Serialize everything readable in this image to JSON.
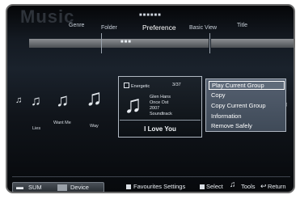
{
  "watermark": "Music",
  "nav_dots": "■■■■■■",
  "tabs": [
    "Genre",
    "Folder",
    "Preference",
    "Basic View",
    "Title"
  ],
  "bar_dots": "■■■",
  "songs": [
    "Lies",
    "Want Me",
    "Way"
  ],
  "selected_song": {
    "checkbox_label": "Energetic",
    "count": "3/37",
    "artist": "Glen Hans",
    "album": "Once Ost",
    "year": "2007",
    "genre": "Soundtrack",
    "title": "I Love You"
  },
  "context_menu": [
    "Play Current Group",
    "Copy",
    "Copy Current Group",
    "Information",
    "Remove Safely"
  ],
  "bottom": {
    "sum_label": "SUM",
    "device_label": "Device",
    "favourites_label": "Favourites Settings",
    "select_label": "Select",
    "tools_label": "Tools",
    "return_label": "Return"
  },
  "icons": [
    "music-note-icon",
    "music-card-icon",
    "remote-sum-icon",
    "device-icon",
    "tools-icon",
    "return-icon"
  ]
}
